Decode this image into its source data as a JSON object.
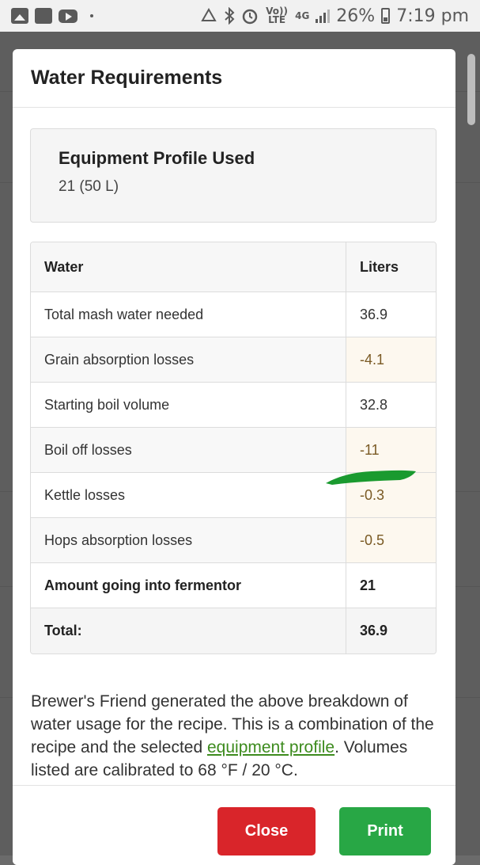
{
  "status_bar": {
    "lte_label": "Vo)) LTE",
    "network": "4G",
    "battery": "26%",
    "time": "7:19 pm"
  },
  "modal": {
    "title": "Water Requirements",
    "profile": {
      "heading": "Equipment Profile Used",
      "value": "21 (50 L)"
    },
    "table": {
      "headers": [
        "Water",
        "Liters"
      ],
      "rows": [
        {
          "label": "Total mash water needed",
          "value": "36.9"
        },
        {
          "label": "Grain absorption losses",
          "value": "-4.1"
        },
        {
          "label": "Starting boil volume",
          "value": "32.8"
        },
        {
          "label": "Boil off losses",
          "value": "-11"
        },
        {
          "label": "Kettle losses",
          "value": "-0.3"
        },
        {
          "label": "Hops absorption losses",
          "value": "-0.5"
        },
        {
          "label": "Amount going into fermentor",
          "value": "21"
        },
        {
          "label": "Total:",
          "value": "36.9"
        }
      ]
    },
    "description": {
      "before_link": "Brewer's Friend generated the above breakdown of water usage for the recipe. This is a combination of the recipe and the selected ",
      "link_text": "equipment profile",
      "after_link": ". Volumes listed are calibrated to 68 °F / 20 °C."
    },
    "buttons": {
      "close": "Close",
      "print": "Print"
    }
  },
  "colors": {
    "close_button": "#d9252a",
    "print_button": "#28a745",
    "loss_cell_bg": "#fdf8ef",
    "link": "#3d8b1e",
    "annotation_mark": "#1a9a2f"
  }
}
